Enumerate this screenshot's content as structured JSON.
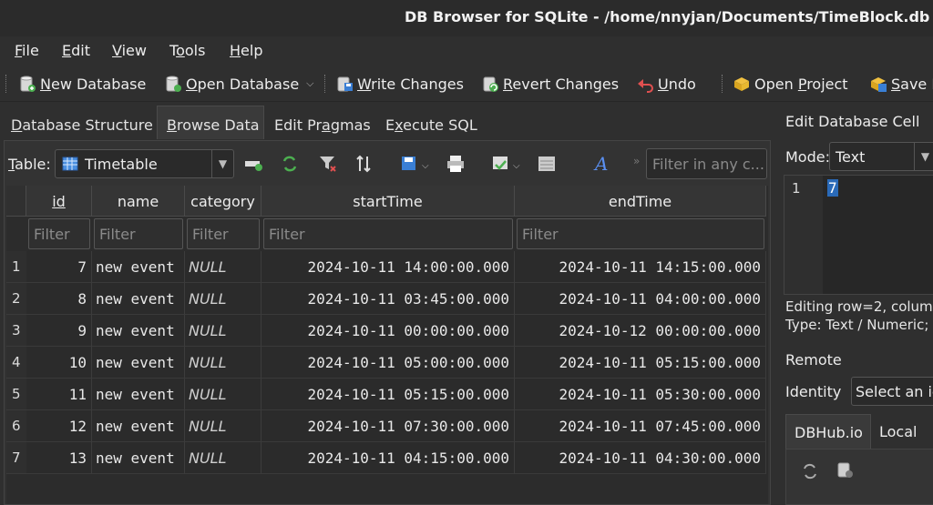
{
  "window": {
    "title": "DB Browser for SQLite - /home/nnyjan/Documents/TimeBlock.db"
  },
  "menu": [
    {
      "pre": "",
      "u": "F",
      "post": "ile"
    },
    {
      "pre": "",
      "u": "E",
      "post": "dit"
    },
    {
      "pre": "",
      "u": "V",
      "post": "iew"
    },
    {
      "pre": "T",
      "u": "o",
      "post": "ols"
    },
    {
      "pre": "",
      "u": "H",
      "post": "elp"
    }
  ],
  "toolbar": {
    "new_db": {
      "u": "N",
      "rest": "ew Database"
    },
    "open_db": {
      "u": "O",
      "rest": "pen Database"
    },
    "write_changes": {
      "u": "W",
      "rest": "rite Changes"
    },
    "revert_changes": {
      "u": "R",
      "rest": "evert Changes"
    },
    "undo": {
      "u": "U",
      "rest": "ndo"
    },
    "open_project": {
      "pre": "Open ",
      "u": "P",
      "rest": "roject"
    },
    "save_project": {
      "pre": "",
      "u": "S",
      "rest": "ave P"
    }
  },
  "tabs": [
    {
      "pre": "",
      "u": "D",
      "post": "atabase Structure"
    },
    {
      "pre": "",
      "u": "B",
      "post": "rowse Data"
    },
    {
      "pre": "Edit Pr",
      "u": "a",
      "post": "gmas"
    },
    {
      "pre": "E",
      "u": "x",
      "post": "ecute SQL"
    }
  ],
  "browse": {
    "table_label_u": "T",
    "table_label_rest": "able:",
    "table_name": "Timetable",
    "filter_any_placeholder": "Filter in any c...",
    "filter_placeholder": "Filter",
    "columns": [
      "id",
      "name",
      "category",
      "startTime",
      "endTime"
    ],
    "rows": [
      {
        "n": "1",
        "id": "7",
        "name": "new event",
        "category": "NULL",
        "start": "2024-10-11 14:00:00.000",
        "end": "2024-10-11 14:15:00.000"
      },
      {
        "n": "2",
        "id": "8",
        "name": "new event",
        "category": "NULL",
        "start": "2024-10-11 03:45:00.000",
        "end": "2024-10-11 04:00:00.000"
      },
      {
        "n": "3",
        "id": "9",
        "name": "new event",
        "category": "NULL",
        "start": "2024-10-11 00:00:00.000",
        "end": "2024-10-12 00:00:00.000"
      },
      {
        "n": "4",
        "id": "10",
        "name": "new event",
        "category": "NULL",
        "start": "2024-10-11 05:00:00.000",
        "end": "2024-10-11 05:15:00.000"
      },
      {
        "n": "5",
        "id": "11",
        "name": "new event",
        "category": "NULL",
        "start": "2024-10-11 05:15:00.000",
        "end": "2024-10-11 05:30:00.000"
      },
      {
        "n": "6",
        "id": "12",
        "name": "new event",
        "category": "NULL",
        "start": "2024-10-11 07:30:00.000",
        "end": "2024-10-11 07:45:00.000"
      },
      {
        "n": "7",
        "id": "13",
        "name": "new event",
        "category": "NULL",
        "start": "2024-10-11 04:15:00.000",
        "end": "2024-10-11 04:30:00.000"
      }
    ]
  },
  "edit_cell": {
    "title": "Edit Database Cell",
    "mode_label": "Mode:",
    "mode_value": "Text",
    "line_number": "1",
    "value": "7",
    "info_line1": "Editing row=2, colum",
    "info_line2": "Type: Text / Numeric;"
  },
  "remote": {
    "title": "Remote",
    "identity_label": "Identity",
    "identity_value": "Select an io",
    "tabs": [
      "DBHub.io",
      "Local"
    ]
  },
  "colors": {
    "selection": "#2a6ab8",
    "background": "#2f2f2f"
  }
}
